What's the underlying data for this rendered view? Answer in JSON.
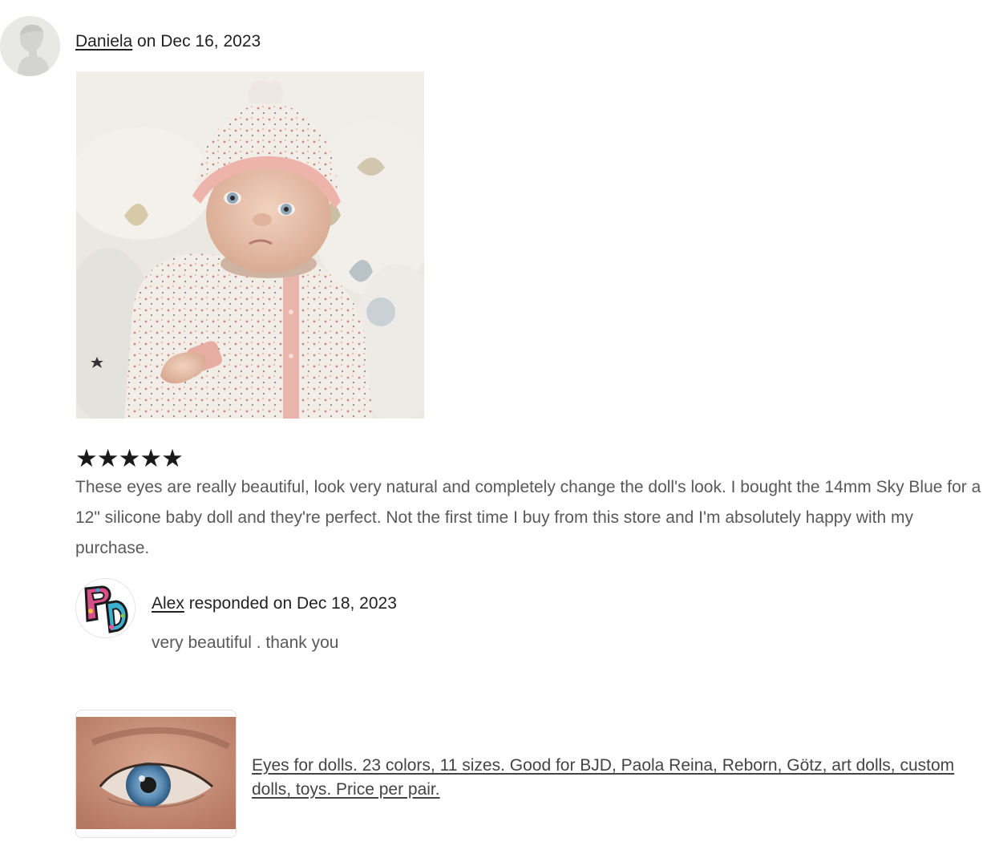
{
  "review": {
    "reviewer_name": "Daniela",
    "date_prefix": " on ",
    "date": "Dec 16, 2023",
    "rating": 5,
    "stars": "★★★★★",
    "text": "These eyes are really beautiful, look very natural and completely change the doll's look. I bought the 14mm Sky Blue for a 12\" silicone baby doll and they're perfect. Not the first time I buy from this store and I'm absolutely happy with my purchase."
  },
  "response": {
    "responder_name": "Alex",
    "responded_prefix": " responded on ",
    "date": "Dec 18, 2023",
    "text": "very beautiful . thank you",
    "avatar_logo_text": "PD"
  },
  "product": {
    "title": "Eyes for dolls. 23 colors, 11 sizes. Good for BJD, Paola Reina, Reborn, Götz, art dolls, custom dolls, toys. Price per pair."
  },
  "colors": {
    "text_primary": "#222222",
    "text_secondary": "#595959",
    "link": "#444444",
    "hat_pink": "#f0b9b0",
    "iris_blue": "#5e8fb8"
  },
  "icons": {
    "reviewer_avatar": "default-user-silhouette-icon",
    "star": "star-icon"
  }
}
